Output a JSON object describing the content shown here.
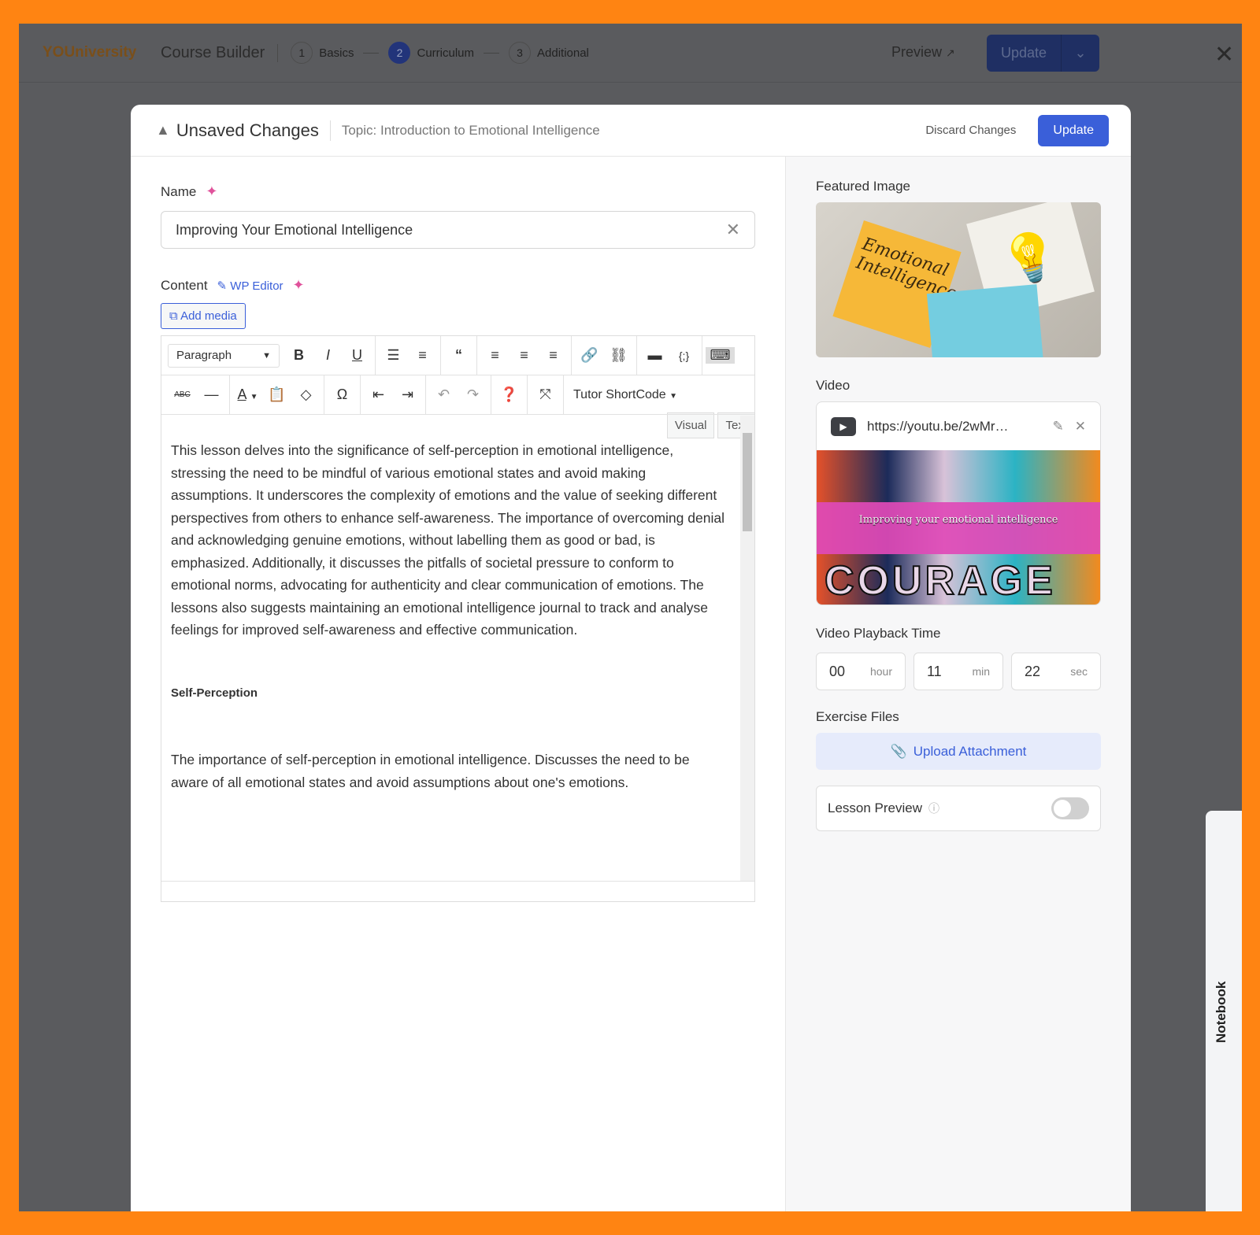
{
  "topbar": {
    "logo": "YOUniversity",
    "title": "Course Builder",
    "steps": [
      {
        "num": "1",
        "label": "Basics"
      },
      {
        "num": "2",
        "label": "Curriculum"
      },
      {
        "num": "3",
        "label": "Additional"
      }
    ],
    "preview": "Preview",
    "update": "Update"
  },
  "modal": {
    "title": "Unsaved Changes",
    "topic": "Topic: Introduction to Emotional Intelligence",
    "discard": "Discard Changes",
    "update": "Update"
  },
  "name": {
    "label": "Name",
    "value": "Improving Your Emotional Intelligence"
  },
  "content": {
    "label": "Content",
    "wp_editor": "WP Editor",
    "add_media": "Add media",
    "tabs": [
      "Visual",
      "Text"
    ],
    "format": "Paragraph",
    "shortcode": "Tutor ShortCode",
    "paragraphs": [
      "This lesson delves into the significance of self-perception in emotional intelligence, stressing the need to be mindful of various emotional states and avoid making assumptions. It underscores the complexity of emotions and the value of seeking different perspectives from others to enhance self-awareness. The importance of overcoming denial and acknowledging genuine emotions, without labelling them as good or bad, is emphasized. Additionally, it discusses the pitfalls of societal pressure to conform to emotional norms, advocating for authenticity and clear communication of emotions. The lessons also suggests maintaining an emotional intelligence journal to track and analyse feelings for improved self-awareness and effective communication.",
      "The importance of self-perception in emotional intelligence. Discusses the need to be aware of all emotional states and avoid assumptions about one's emotions."
    ],
    "heading": "Self-Perception"
  },
  "featured": {
    "label": "Featured Image",
    "note_text": "Emotional Intelligence"
  },
  "video": {
    "label": "Video",
    "url": "https://youtu.be/2wMr…",
    "thumb_title": "Improving your emotional intelligence",
    "thumb_word": "COURAGE"
  },
  "playback": {
    "label": "Video Playback Time",
    "hour": "00",
    "hour_unit": "hour",
    "min": "11",
    "min_unit": "min",
    "sec": "22",
    "sec_unit": "sec"
  },
  "exercise": {
    "label": "Exercise Files",
    "upload": "Upload Attachment"
  },
  "lesson_preview": {
    "label": "Lesson Preview",
    "enabled": false
  },
  "notebook": "Notebook",
  "colors": {
    "accent": "#3a5fd9",
    "frame": "#ff8412"
  }
}
